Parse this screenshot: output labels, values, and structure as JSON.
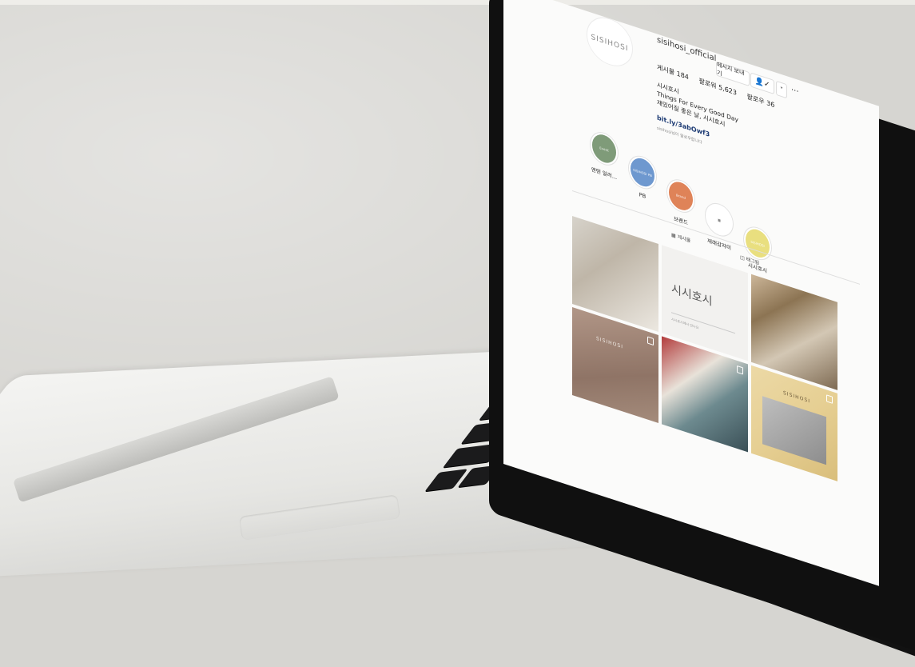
{
  "profile": {
    "logo_text": "SISIHOSI",
    "username": "sisihosi_official",
    "buttons": {
      "message": "메시지 보내기",
      "follow_icon": "👤✓",
      "more_icon": "˅",
      "options": "···"
    },
    "stats": {
      "posts": "게시물 184",
      "followers": "팔로워 5,623",
      "following": "팔로우 36"
    },
    "bio": [
      "시시호시",
      "Things For Every Good Day",
      "재밌어질 좋은 날, 시시호시"
    ],
    "link": "bit.ly/3abOwf3",
    "followed_by": "sisihosi님이 팔로우합니다"
  },
  "highlights": [
    {
      "label": "엔텐 일러...",
      "color": "#7f9b79",
      "inner": "Event"
    },
    {
      "label": "PB",
      "color": "#6e98cf",
      "inner": "SISIHOSI PB"
    },
    {
      "label": "브랜드",
      "color": "#df8358",
      "inner": "Brand"
    },
    {
      "label": "재래감자미",
      "color": "#ffffff",
      "inner": ""
    },
    {
      "label": "시시호시",
      "color": "#e9df7f",
      "inner": "SISIHOSI"
    }
  ],
  "tabs": [
    "게시물",
    "태그됨"
  ],
  "posts": {
    "title": "시시호시",
    "small_text": "시시호시에서 만나요",
    "logo": "SISIHOSI"
  }
}
